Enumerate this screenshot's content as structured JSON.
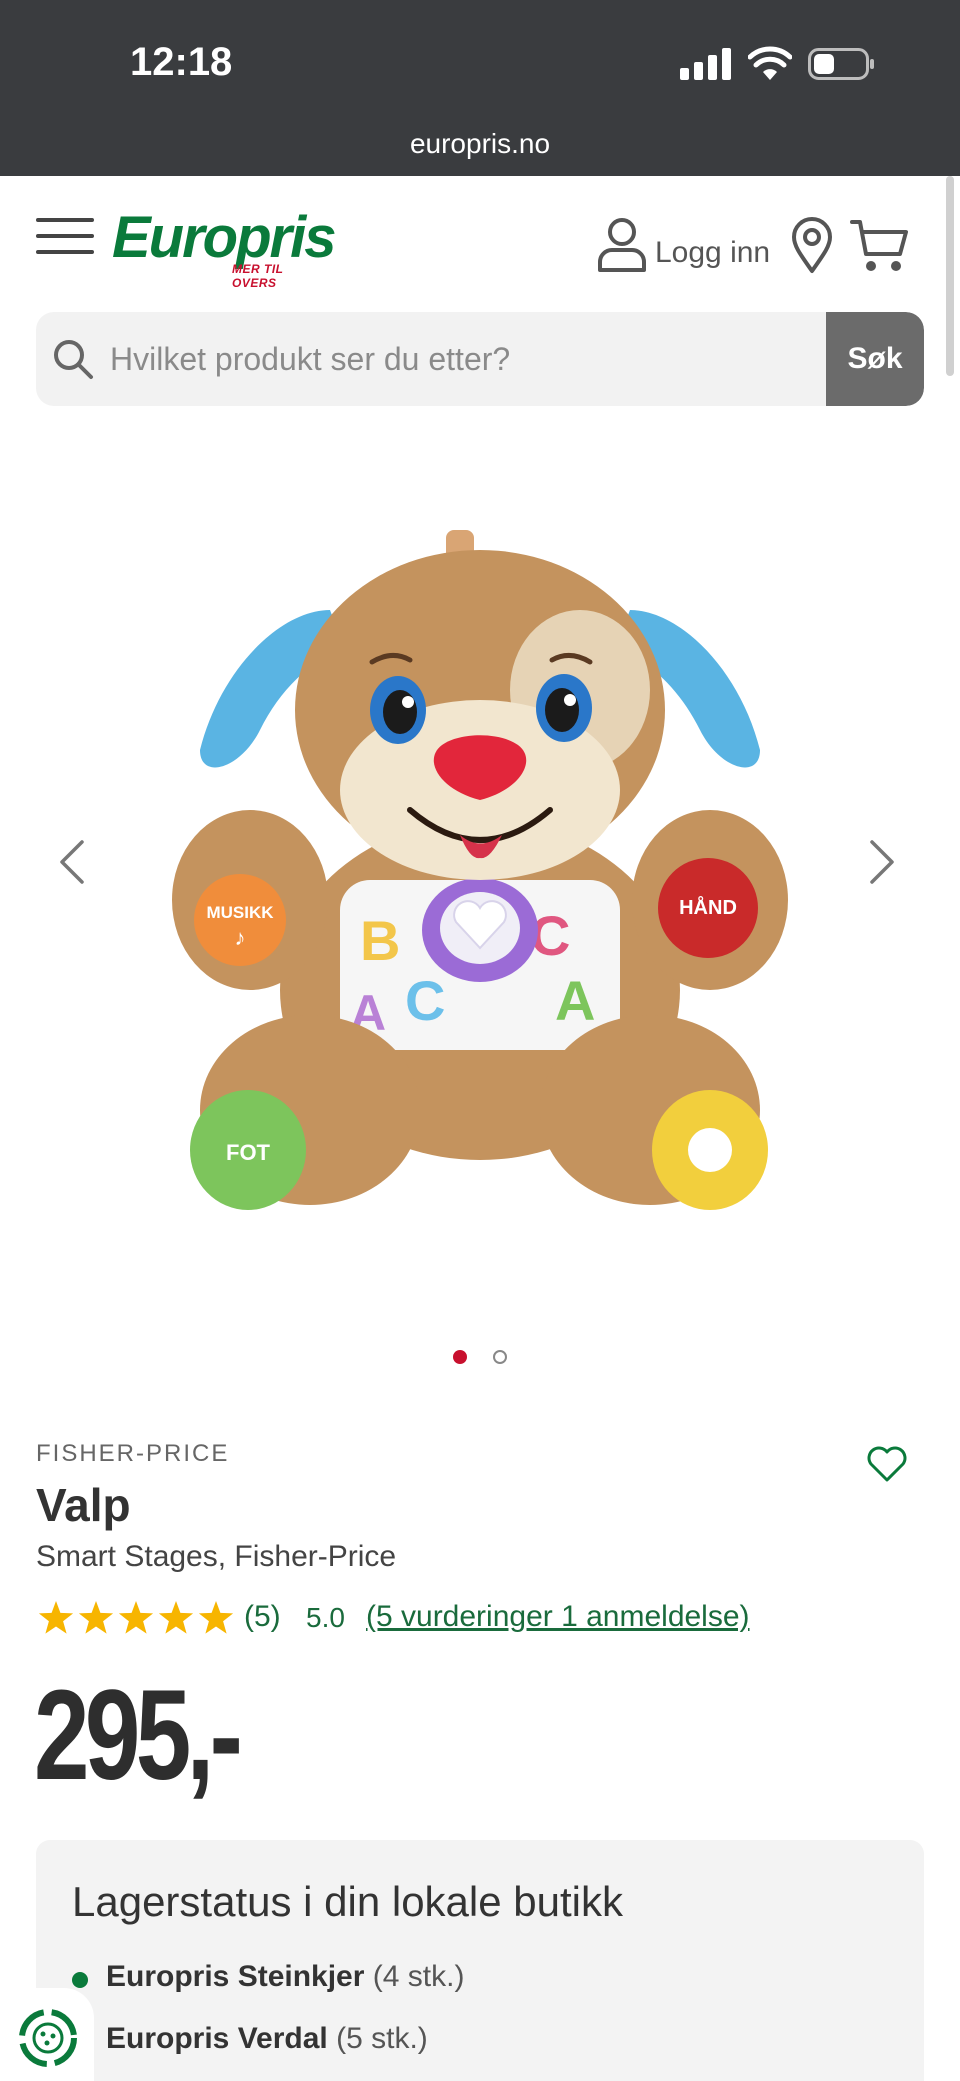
{
  "status_bar": {
    "time": "12:18"
  },
  "browser": {
    "url": "europris.no"
  },
  "header": {
    "logo_text": "Europris",
    "logo_tagline": "MER TIL OVERS",
    "login_label": "Logg inn"
  },
  "search": {
    "placeholder": "Hvilket produkt ser du etter?",
    "button_label": "Søk"
  },
  "gallery": {
    "image_count": 2,
    "active_index": 1
  },
  "product": {
    "brand": "FISHER-PRICE",
    "title": "Valp",
    "subtitle": "Smart Stages, Fisher-Price",
    "rating_stars": 5,
    "rating_count": "(5)",
    "rating_score": "5.0",
    "rating_link": "(5 vurderinger 1 anmeldelse)",
    "price": "295,-",
    "toy_labels": {
      "left_hand": "MUSIKK",
      "right_hand": "HÅND",
      "left_foot": "FOT"
    }
  },
  "stock": {
    "title": "Lagerstatus i din lokale butikk",
    "stores": [
      {
        "name": "Europris Steinkjer",
        "qty": "(4 stk.)"
      },
      {
        "name": "Europris Verdal",
        "qty": "(5 stk.)"
      }
    ]
  },
  "colors": {
    "brand_green": "#0a7a3b",
    "brand_red": "#c8102e",
    "star": "#f7b500",
    "link": "#1a6b3c"
  }
}
